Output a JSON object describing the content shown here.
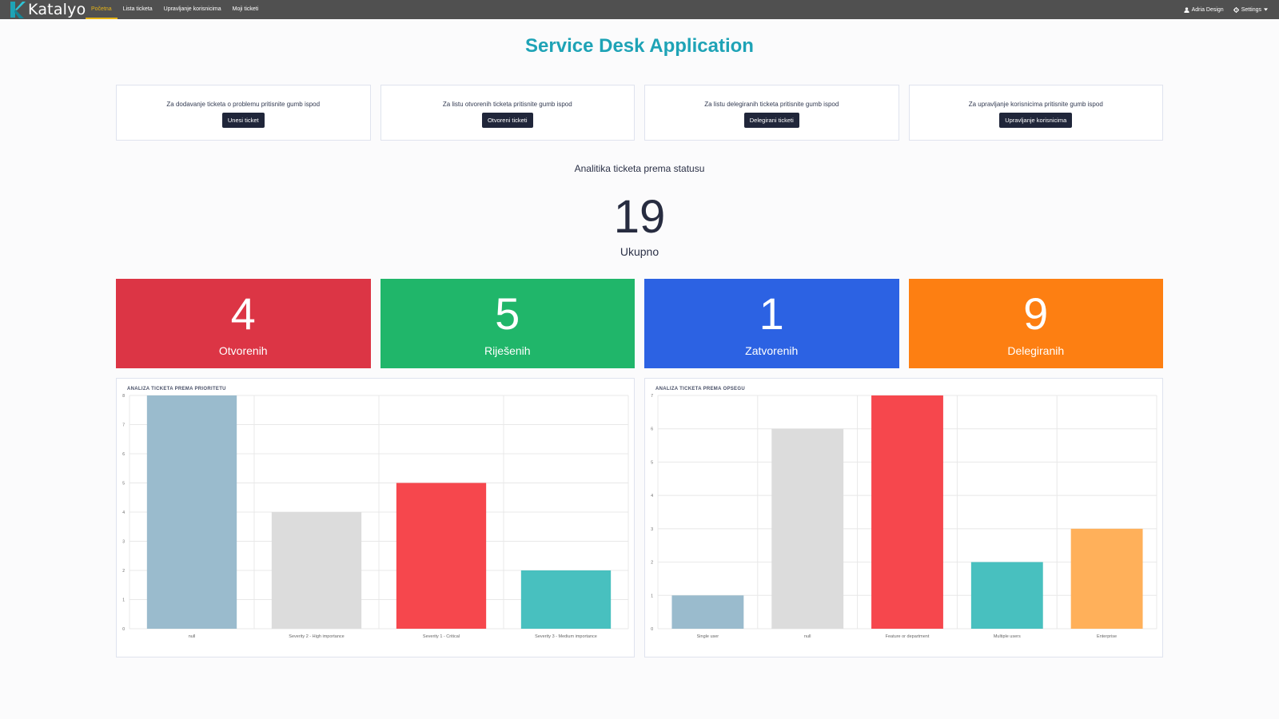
{
  "navbar": {
    "brand": "Katalyo",
    "links": [
      "Početna",
      "Lista ticketa",
      "Upravljanje korisnicima",
      "Moji ticketi"
    ],
    "user_name": "Adria Design",
    "settings_label": "Settings"
  },
  "page_title": "Service Desk Application",
  "info_cards": [
    {
      "text": "Za dodavanje ticketa o problemu pritisnite gumb ispod",
      "button": "Unesi ticket"
    },
    {
      "text": "Za listu otvorenih ticketa pritisnite gumb ispod",
      "button": "Otvoreni ticketi"
    },
    {
      "text": "Za listu delegiranih ticketa pritisnite gumb ispod",
      "button": "Delegirani ticketi"
    },
    {
      "text": "Za upravljanje korisnicima pritisnite gumb ispod",
      "button": "Upravljanje korisnicima"
    }
  ],
  "analytics": {
    "title": "Analitika ticketa prema statusu",
    "total_value": "19",
    "total_label": "Ukupno"
  },
  "stats": [
    {
      "value": "4",
      "label": "Otvorenih",
      "color": "#dc3545"
    },
    {
      "value": "5",
      "label": "Riješenih",
      "color": "#20b66a"
    },
    {
      "value": "1",
      "label": "Zatvorenih",
      "color": "#2c62e3"
    },
    {
      "value": "9",
      "label": "Delegiranih",
      "color": "#fd7f12"
    }
  ],
  "chart_data": [
    {
      "type": "bar",
      "title": "ANALIZA TICKETA PREMA PRIORITETU",
      "categories": [
        "null",
        "Severity 2 - High importance",
        "Severity 1 - Critical",
        "Severity 3 - Medium importance"
      ],
      "values": [
        8,
        4,
        5,
        2
      ],
      "colors": [
        "#9abbcd",
        "#dcdcdc",
        "#f6474d",
        "#48c0bf"
      ],
      "ylim": [
        0,
        8
      ],
      "yticks": [
        0,
        1,
        2,
        3,
        4,
        5,
        6,
        7,
        8
      ],
      "grid": true
    },
    {
      "type": "bar",
      "title": "ANALIZA TICKETA PREMA OPSEGU",
      "categories": [
        "Single user",
        "null",
        "Feature or department",
        "Multiple users",
        "Enterprise"
      ],
      "values": [
        1,
        6,
        7,
        2,
        3
      ],
      "colors": [
        "#9abbcd",
        "#dcdcdc",
        "#f6474d",
        "#48c0bf",
        "#ffb05a"
      ],
      "ylim": [
        0,
        7
      ],
      "yticks": [
        0,
        1,
        2,
        3,
        4,
        5,
        6,
        7
      ],
      "grid": true
    }
  ]
}
